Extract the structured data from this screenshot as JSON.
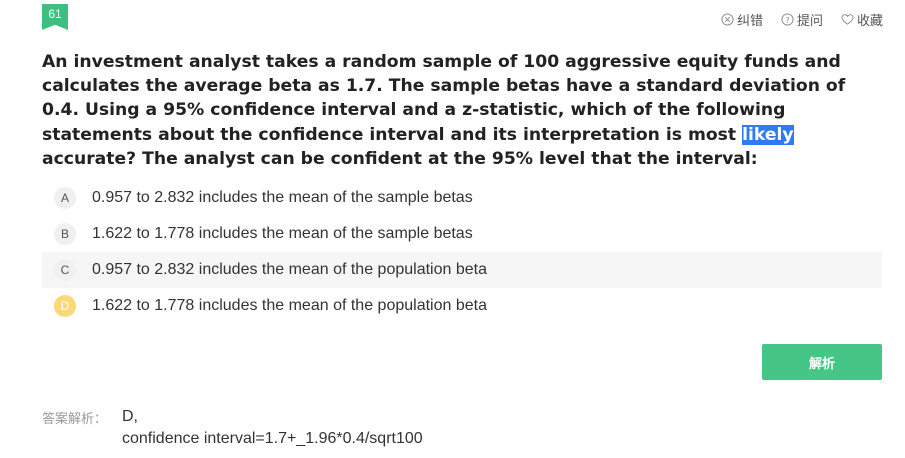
{
  "question_number": "61",
  "toolbar": {
    "report_label": "纠错",
    "ask_label": "提问",
    "favorite_label": "收藏"
  },
  "question": {
    "text_before": "An investment analyst takes a random sample of 100 aggressive equity funds and calculates the average beta as 1.7. The sample betas have a standard deviation of 0.4. Using a 95% confidence interval and a z-statistic, which of the following statements about the confidence interval and its interpretation is most ",
    "highlighted": "likely",
    "text_after": " accurate? The analyst can be confident at the 95% level that the interval:"
  },
  "options": [
    {
      "letter": "A",
      "text": "0.957 to 2.832 includes the mean of the sample betas"
    },
    {
      "letter": "B",
      "text": "1.622 to 1.778 includes the mean of the sample betas"
    },
    {
      "letter": "C",
      "text": "0.957 to 2.832 includes the mean of the population beta"
    },
    {
      "letter": "D",
      "text": "1.622 to 1.778 includes the mean of the population beta"
    }
  ],
  "analyze_button": "解析",
  "answer": {
    "label": "答案解析：",
    "line1": "D,",
    "line2": "confidence interval=1.7+_1.96*0.4/sqrt100"
  },
  "colors": {
    "accent": "#45c686",
    "highlight": "#2f7bf0",
    "correct_option": "#fcd878"
  }
}
